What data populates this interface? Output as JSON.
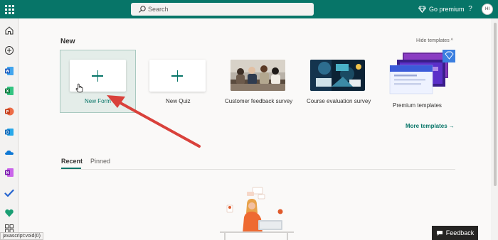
{
  "topbar": {
    "search_placeholder": "Search",
    "premium_label": "Go premium",
    "help_label": "?",
    "avatar_initials": "HI"
  },
  "rail": {
    "icons": [
      "home-icon",
      "create-icon",
      "word-icon",
      "excel-icon",
      "powerpoint-icon",
      "outlook-icon",
      "onedrive-icon",
      "onenote-icon",
      "todo-icon",
      "viva-icon",
      "all-apps-icon"
    ]
  },
  "new_section": {
    "title": "New",
    "hide_templates": "Hide templates ^",
    "templates": [
      {
        "label": "New Form"
      },
      {
        "label": "New Quiz"
      },
      {
        "label": "Customer feedback survey"
      },
      {
        "label": "Course evaluation survey"
      },
      {
        "label": "Premium templates"
      }
    ],
    "more_templates": "More templates →"
  },
  "tabs": {
    "recent": "Recent",
    "pinned": "Pinned"
  },
  "status_url": "javascript:void(0)",
  "feedback_label": "Feedback",
  "colors": {
    "brand": "#077568",
    "annotation_arrow": "#d9413b"
  }
}
